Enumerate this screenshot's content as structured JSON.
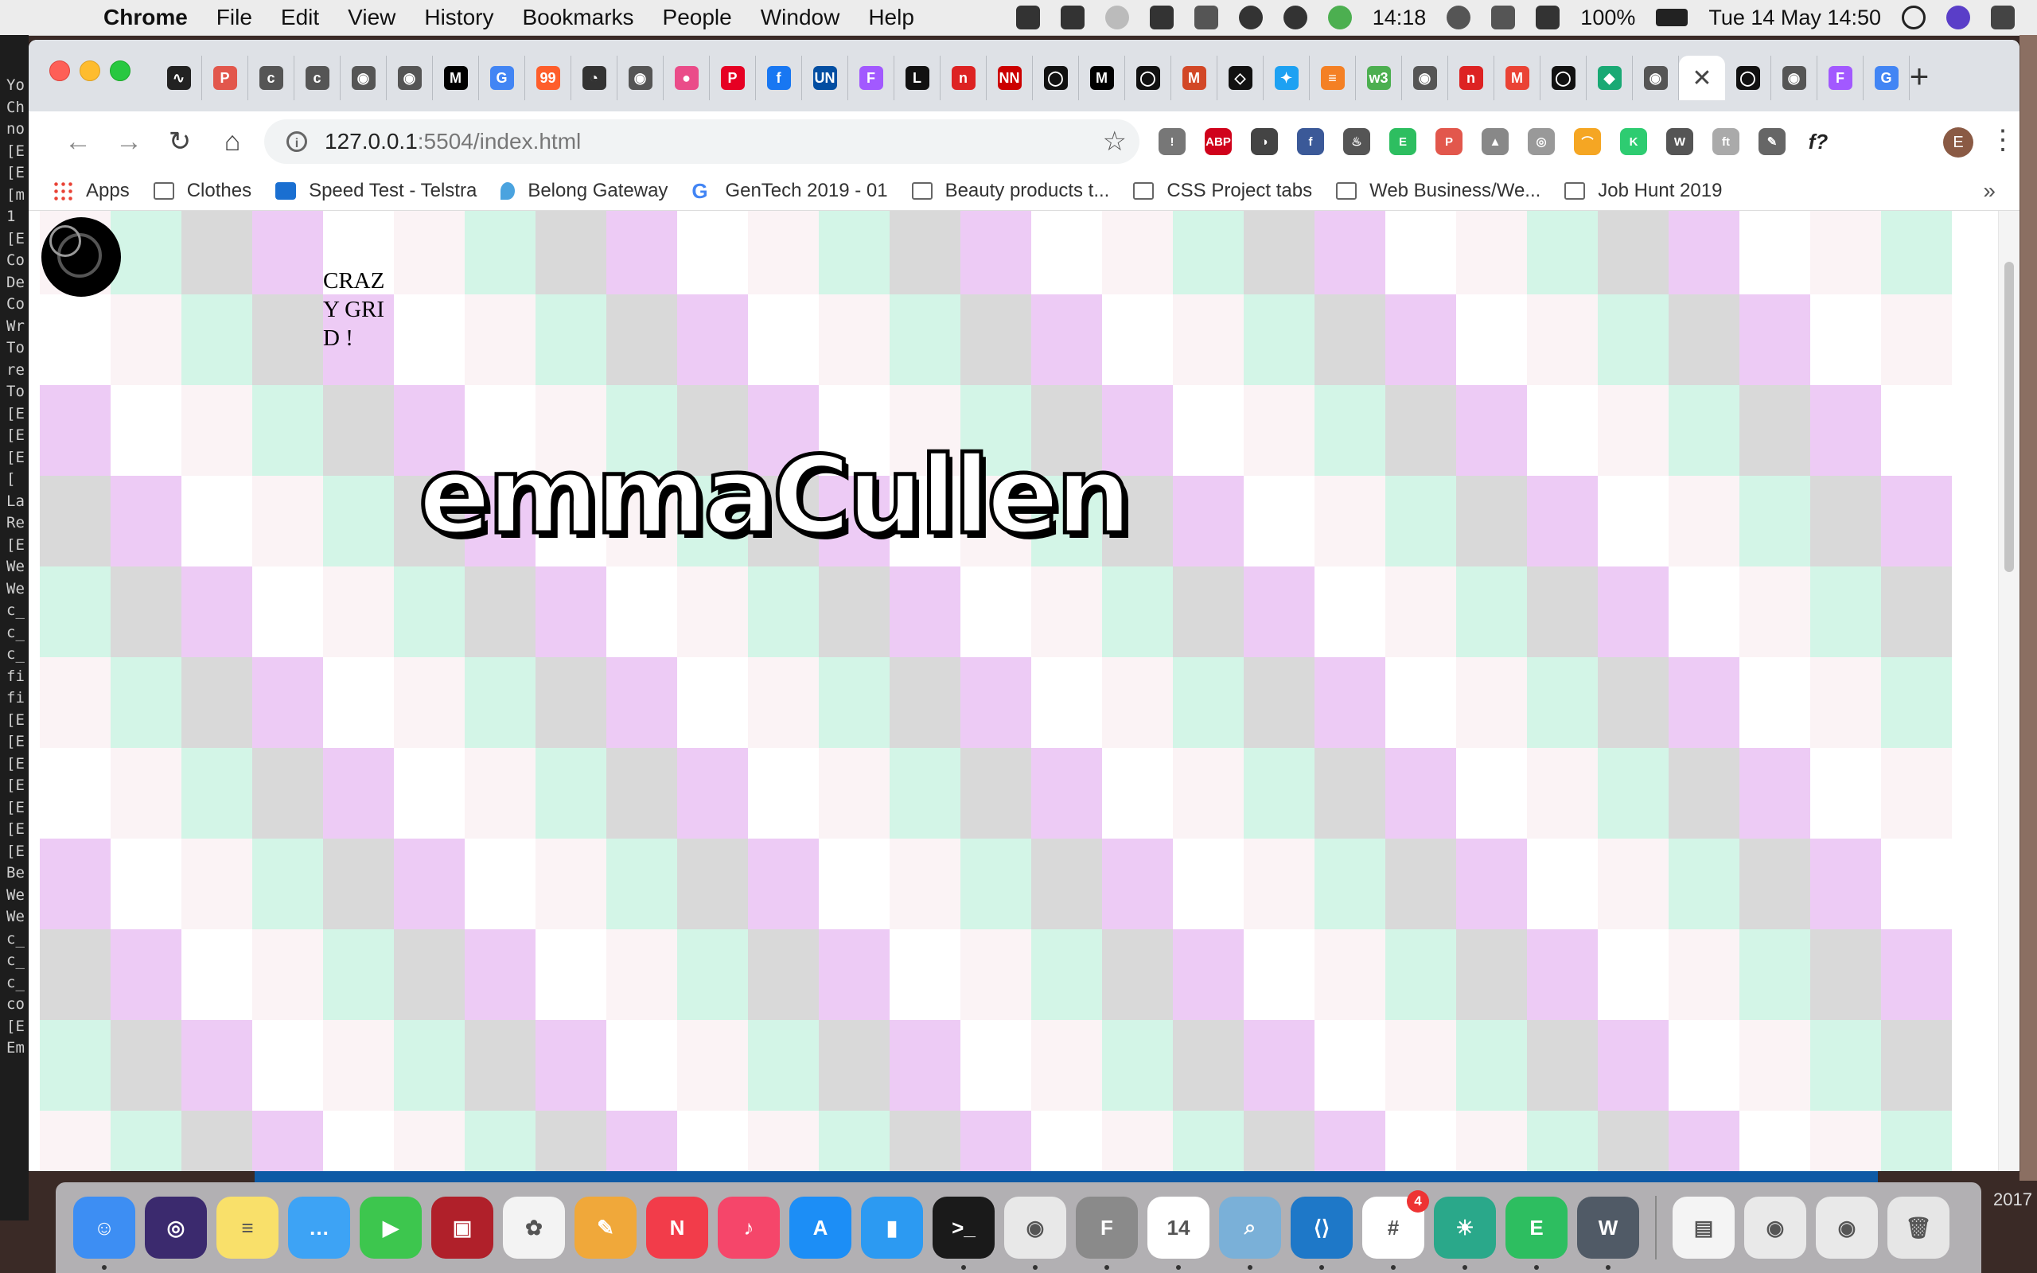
{
  "menubar": {
    "app_name": "Chrome",
    "items": [
      "File",
      "Edit",
      "View",
      "History",
      "Bookmarks",
      "People",
      "Window",
      "Help"
    ],
    "status": {
      "timer": "14:18",
      "battery": "100%",
      "datetime": "Tue 14 May  14:50"
    }
  },
  "terminal_lines": [
    "Yo",
    "Ch",
    "",
    "no",
    "[E",
    "[E",
    "[m",
    "1",
    "[E",
    "Co",
    "De",
    "Co",
    "Wr",
    "To",
    "re",
    "To",
    "",
    "[E",
    "[E",
    "[E",
    "[",
    "La",
    "Re",
    "[E",
    "We",
    "We",
    "c_",
    "c_",
    "c_",
    "fi",
    "fi",
    "[E",
    "[E",
    "[E",
    "[E",
    "[E",
    "[E",
    "[E",
    "Be",
    "We",
    "We",
    "c_",
    "c_",
    "c_",
    "co",
    "[E",
    "Em"
  ],
  "browser": {
    "tabs": [
      {
        "icon": "audio-wave-icon",
        "color": "#222",
        "glyph": "∿"
      },
      {
        "icon": "pdf-icon",
        "color": "#e2574c",
        "glyph": "P"
      },
      {
        "icon": "codepen-c-icon",
        "color": "#555",
        "glyph": "c"
      },
      {
        "icon": "codepen-c-icon",
        "color": "#555",
        "glyph": "c"
      },
      {
        "icon": "globe-icon",
        "color": "#555",
        "glyph": "◉"
      },
      {
        "icon": "globe-icon",
        "color": "#555",
        "glyph": "◉"
      },
      {
        "icon": "medium-icon",
        "color": "#000",
        "glyph": "M"
      },
      {
        "icon": "google-icon",
        "color": "#4285f4",
        "glyph": "G"
      },
      {
        "icon": "99designs-icon",
        "color": "#fe5e2b",
        "glyph": "99"
      },
      {
        "icon": "meter-icon",
        "color": "#333",
        "glyph": "◔"
      },
      {
        "icon": "globe-icon",
        "color": "#555",
        "glyph": "◉"
      },
      {
        "icon": "dribbble-icon",
        "color": "#ea4c89",
        "glyph": "●"
      },
      {
        "icon": "pinterest-icon",
        "color": "#e60023",
        "glyph": "P"
      },
      {
        "icon": "facebook-icon",
        "color": "#1877f2",
        "glyph": "f"
      },
      {
        "icon": "un-icon",
        "color": "#034ea2",
        "glyph": "UN"
      },
      {
        "icon": "figma-icon",
        "color": "#a259ff",
        "glyph": "F"
      },
      {
        "icon": "l-icon",
        "color": "#111",
        "glyph": "L"
      },
      {
        "icon": "red-doc-icon",
        "color": "#d22",
        "glyph": "n"
      },
      {
        "icon": "nn-icon",
        "color": "#c00",
        "glyph": "NN"
      },
      {
        "icon": "github-icon",
        "color": "#111",
        "glyph": "◯"
      },
      {
        "icon": "medium-icon",
        "color": "#000",
        "glyph": "M"
      },
      {
        "icon": "github-icon",
        "color": "#111",
        "glyph": "◯"
      },
      {
        "icon": "m-red-icon",
        "color": "#d24726",
        "glyph": "M"
      },
      {
        "icon": "codepen-icon",
        "color": "#111",
        "glyph": "◇"
      },
      {
        "icon": "bird-icon",
        "color": "#1da1f2",
        "glyph": "✦"
      },
      {
        "icon": "stack-icon",
        "color": "#f48024",
        "glyph": "≡"
      },
      {
        "icon": "w3-icon",
        "color": "#4caf50",
        "glyph": "w3"
      },
      {
        "icon": "globe-icon",
        "color": "#555",
        "glyph": "◉"
      },
      {
        "icon": "red-doc-icon",
        "color": "#d22",
        "glyph": "n"
      },
      {
        "icon": "gmail-icon",
        "color": "#ea4335",
        "glyph": "M"
      },
      {
        "icon": "github-icon",
        "color": "#111",
        "glyph": "◯"
      },
      {
        "icon": "diamond-icon",
        "color": "#19a974",
        "glyph": "◆"
      },
      {
        "icon": "globe-icon",
        "color": "#555",
        "glyph": "◉"
      },
      {
        "icon": "close-icon",
        "active": true,
        "glyph": "✕"
      },
      {
        "icon": "github-icon",
        "color": "#111",
        "glyph": "◯"
      },
      {
        "icon": "globe-icon",
        "color": "#555",
        "glyph": "◉"
      },
      {
        "icon": "figma-icon",
        "color": "#a259ff",
        "glyph": "F"
      },
      {
        "icon": "google-icon",
        "color": "#4285f4",
        "glyph": "G"
      }
    ],
    "url_host": "127.0.0.1",
    "url_rest": ":5504/index.html",
    "extensions": [
      {
        "icon": "extension-alert-icon",
        "color": "#777",
        "glyph": "!"
      },
      {
        "icon": "adblock-icon",
        "color": "#d0021b",
        "glyph": "ABP"
      },
      {
        "icon": "spy-icon",
        "color": "#444",
        "glyph": "◑"
      },
      {
        "icon": "facebook-ext-icon",
        "color": "#3b5998",
        "glyph": "f"
      },
      {
        "icon": "flame-icon",
        "color": "#555",
        "glyph": "♨"
      },
      {
        "icon": "evernote-icon",
        "color": "#2dbe60",
        "glyph": "E"
      },
      {
        "icon": "pdf-ext-icon",
        "color": "#e2574c",
        "glyph": "P"
      },
      {
        "icon": "drive-icon",
        "color": "#888",
        "glyph": "▲"
      },
      {
        "icon": "globe-ext-icon",
        "color": "#999",
        "glyph": "◎"
      },
      {
        "icon": "rainbow-icon",
        "color": "#f5a623",
        "glyph": "⌒"
      },
      {
        "icon": "k-icon",
        "color": "#2ecc71",
        "glyph": "K"
      },
      {
        "icon": "w-icon",
        "color": "#555",
        "glyph": "W"
      },
      {
        "icon": "font-icon",
        "color": "#aaa",
        "glyph": "ft"
      },
      {
        "icon": "eyedropper-icon",
        "color": "#666",
        "glyph": "✎"
      },
      {
        "icon": "function-icon",
        "color": "#fff",
        "glyph": "f?"
      }
    ],
    "profile_initial": "E",
    "bookmarks": [
      {
        "label": "Apps",
        "icon": "apps-grid-icon"
      },
      {
        "label": "Clothes",
        "icon": "folder-icon"
      },
      {
        "label": "Speed Test - Telstra",
        "icon": "telstra-icon"
      },
      {
        "label": "Belong Gateway",
        "icon": "location-pin-icon"
      },
      {
        "label": "GenTech 2019 - 01",
        "icon": "google-icon"
      },
      {
        "label": "Beauty products t...",
        "icon": "folder-icon"
      },
      {
        "label": "CSS Project tabs",
        "icon": "folder-icon"
      },
      {
        "label": "Web Business/We...",
        "icon": "folder-icon"
      },
      {
        "label": "Job Hunt 2019",
        "icon": "folder-icon"
      }
    ],
    "bookmarks_more": "»"
  },
  "page": {
    "crazy_grid_text": "CRAZY GRID !",
    "title": "emmaCullen",
    "grid_colors": [
      "#fbf3f5",
      "#d3f5e7",
      "#d9d9d9",
      "#edcbf5",
      "#ffffff"
    ]
  },
  "dock_apps": [
    {
      "icon": "finder-icon",
      "color": "#3d8ef3",
      "glyph": "☺",
      "running": true
    },
    {
      "icon": "siri-icon",
      "color": "#3b2a6e",
      "glyph": "◎"
    },
    {
      "icon": "notes-icon",
      "color": "#f9e06a",
      "glyph": "≡"
    },
    {
      "icon": "messages-icon",
      "color": "#3da3f5",
      "glyph": "…"
    },
    {
      "icon": "facetime-icon",
      "color": "#3dc64e",
      "glyph": "▶"
    },
    {
      "icon": "photo-booth-icon",
      "color": "#b0202a",
      "glyph": "▣"
    },
    {
      "icon": "photos-icon",
      "color": "#f3f3f3",
      "glyph": "✿"
    },
    {
      "icon": "pages-icon",
      "color": "#f0a83a",
      "glyph": "✎"
    },
    {
      "icon": "news-icon",
      "color": "#f23c4a",
      "glyph": "N"
    },
    {
      "icon": "music-icon",
      "color": "#f5466a",
      "glyph": "♪"
    },
    {
      "icon": "app-store-icon",
      "color": "#1c8ef6",
      "glyph": "A"
    },
    {
      "icon": "bookmark-app-icon",
      "color": "#2c9af2",
      "glyph": "▮"
    },
    {
      "icon": "terminal-icon",
      "color": "#1a1a1a",
      "glyph": ">_",
      "running": true
    },
    {
      "icon": "chrome-icon",
      "color": "#e8e8e8",
      "glyph": "◉",
      "running": true
    },
    {
      "icon": "font-book-icon",
      "color": "#8a8a8a",
      "glyph": "F",
      "running": true
    },
    {
      "icon": "calendar-icon",
      "color": "#ffffff",
      "glyph": "14",
      "running": true
    },
    {
      "icon": "preview-icon",
      "color": "#7ab0d8",
      "glyph": "⌕",
      "running": true
    },
    {
      "icon": "vscode-icon",
      "color": "#1e78c8",
      "glyph": "⟨⟩",
      "running": true
    },
    {
      "icon": "slack-icon",
      "color": "#ffffff",
      "glyph": "#",
      "badge": "4",
      "running": true
    },
    {
      "icon": "island-icon",
      "color": "#2aa88a",
      "glyph": "☀",
      "running": true
    },
    {
      "icon": "evernote-dock-icon",
      "color": "#2dbe60",
      "glyph": "E",
      "running": true
    },
    {
      "icon": "wordpress-dock-icon",
      "color": "#505a66",
      "glyph": "W",
      "running": true
    },
    {
      "divider": true
    },
    {
      "icon": "doc-thumb-icon",
      "color": "#f4f4f4",
      "glyph": "▤"
    },
    {
      "icon": "window-thumb-icon",
      "color": "#e9e9e9",
      "glyph": "◉"
    },
    {
      "icon": "window-thumb-icon",
      "color": "#e9e9e9",
      "glyph": "◉"
    },
    {
      "icon": "trash-icon",
      "color": "#e6e6e6",
      "glyph": "🗑"
    }
  ],
  "desktop_right_label": "2017"
}
